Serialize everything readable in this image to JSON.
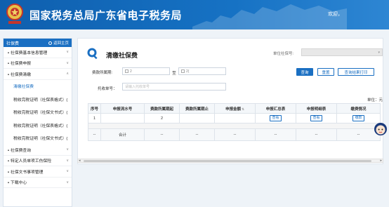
{
  "header": {
    "site_title": "国家税务总局广东省电子税务局",
    "welcome": "欢迎，"
  },
  "sidebar": {
    "title": "社保费",
    "home_link": "返回主页",
    "items": [
      {
        "label": "社保费基本信息管理",
        "expanded": false
      },
      {
        "label": "社保费申报",
        "expanded": false
      },
      {
        "label": "社保费清缴",
        "expanded": true
      },
      {
        "label": "社保费查询",
        "expanded": false
      },
      {
        "label": "特定人员单项工伤保险",
        "expanded": false
      },
      {
        "label": "社保文书事项管理",
        "expanded": false
      },
      {
        "label": "下载中心",
        "expanded": false
      }
    ],
    "subitems": [
      {
        "label": "清缴社保费",
        "active": true
      },
      {
        "label": "税收完税证明（社保表格式）(",
        "active": false
      },
      {
        "label": "税收完税证明（社保文书式）(",
        "active": false
      },
      {
        "label": "税收完税证明（社保表格式）(",
        "active": false
      },
      {
        "label": "税收完税证明（社保文书式）(",
        "active": false
      }
    ]
  },
  "main": {
    "page_title": "清缴社保费",
    "tax_number_label": "单位社保号:",
    "tax_number_value": "",
    "period_label": "费款所属期:",
    "period_from": "2",
    "period_to_sep": "至",
    "period_to": "2(",
    "voucher_label": "托收单号：",
    "voucher_placeholder": "请输入托收单号",
    "buttons": {
      "query": "查询",
      "reset": "重置",
      "print": "查询结果打印"
    },
    "unit_text": "单位：元",
    "table": {
      "headers": [
        "序号",
        "申报流水号",
        "费款所属期起",
        "费款所属期止",
        "申报金额",
        "申报汇总表",
        "申报明细表",
        "缴费情况"
      ],
      "sortable_index": 4,
      "rows": [
        {
          "seq": "1",
          "serial": "",
          "period_start": "2",
          "period_end": "",
          "amount": "",
          "summary": "查看",
          "detail": "查看",
          "payment": "缴款"
        }
      ],
      "total_row": [
        "--",
        "合计",
        "--",
        "--",
        "--",
        "--",
        "--",
        "--"
      ]
    }
  },
  "colors": {
    "brand_blue": "#1a6fc2",
    "header_blue": "#0f5fae"
  },
  "icons": {
    "logo": "tax-emblem-icon",
    "page": "search-magnifier-icon",
    "home": "home-icon"
  }
}
